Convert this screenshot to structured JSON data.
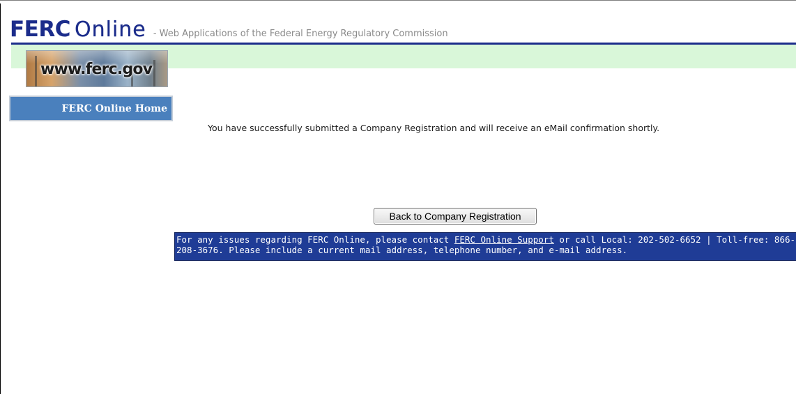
{
  "header": {
    "logo_ferc": "FERC",
    "logo_online": "Online",
    "tagline": "- Web Applications of the Federal Energy Regulatory Commission"
  },
  "banner": {
    "text": "www.ferc.gov"
  },
  "nav": {
    "home_label": "FERC Online Home"
  },
  "main": {
    "success_message": "You have successfully submitted a Company Registration and will receive an eMail confirmation shortly.",
    "back_button_label": "Back to Company Registration"
  },
  "support": {
    "text_before_link": "For any issues regarding FERC Online, please contact ",
    "link_label": "FERC Online Support",
    "text_after_link": " or call Local: 202-502-6652 | Toll-free: 866-208-3676. Please include a current mail address, telephone number, and e-mail address."
  },
  "colors": {
    "brand_navy": "#1b2c8b",
    "header_band": "#d9f7d9",
    "nav_blue": "#4a80bd",
    "support_blue": "#1f3c96"
  }
}
